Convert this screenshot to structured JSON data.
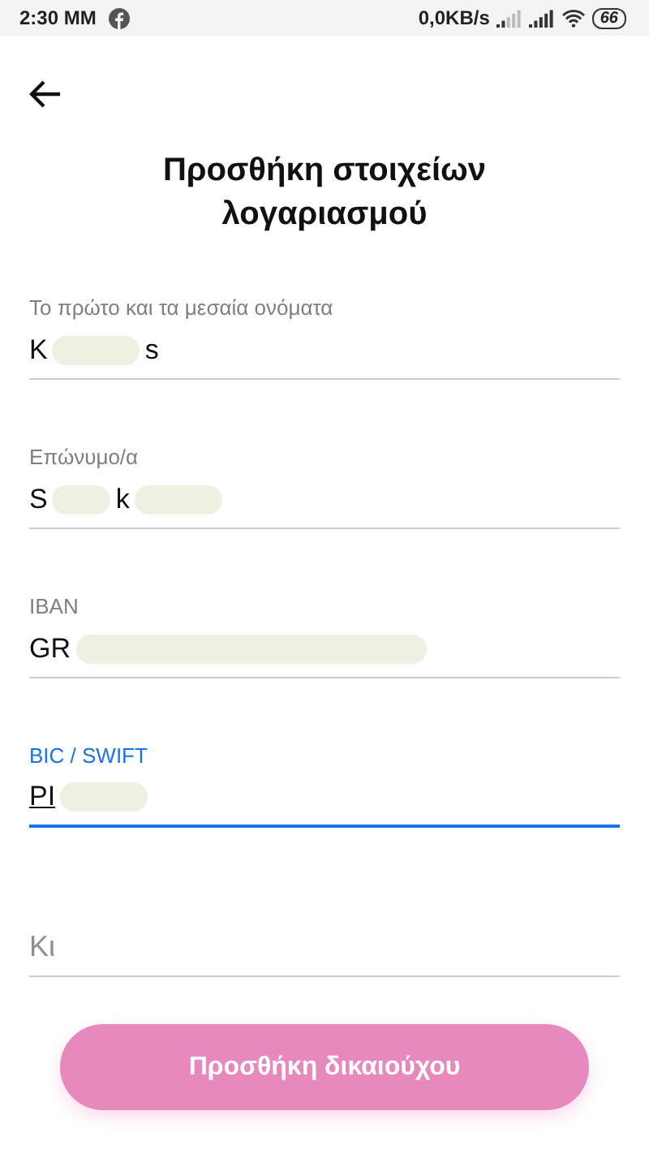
{
  "status_bar": {
    "time": "2:30 ΜΜ",
    "speed": "0,0KB/s",
    "battery": "66"
  },
  "title": "Προσθήκη στοιχείων λογαριασμού",
  "fields": [
    {
      "label": "Το πρώτο και τα μεσαία ονόματα",
      "focused": false,
      "segments": [
        {
          "kind": "text",
          "text": "K"
        },
        {
          "kind": "redacted"
        },
        {
          "kind": "text",
          "text": "s"
        }
      ]
    },
    {
      "label": "Επώνυμο/α",
      "focused": false,
      "segments": [
        {
          "kind": "text",
          "text": "S"
        },
        {
          "kind": "redacted"
        },
        {
          "kind": "text",
          "text": "k"
        },
        {
          "kind": "redacted"
        }
      ]
    },
    {
      "label": "IBAN",
      "focused": false,
      "segments": [
        {
          "kind": "text",
          "text": "GR"
        },
        {
          "kind": "redacted"
        }
      ]
    },
    {
      "label": "BIC / SWIFT",
      "focused": true,
      "segments": [
        {
          "kind": "text",
          "text": "PI"
        },
        {
          "kind": "redacted"
        }
      ]
    },
    {
      "placeholder": "Κι",
      "focused": false
    }
  ],
  "submit": {
    "label": "Προσθήκη δικαιούχου",
    "disabled": true
  }
}
